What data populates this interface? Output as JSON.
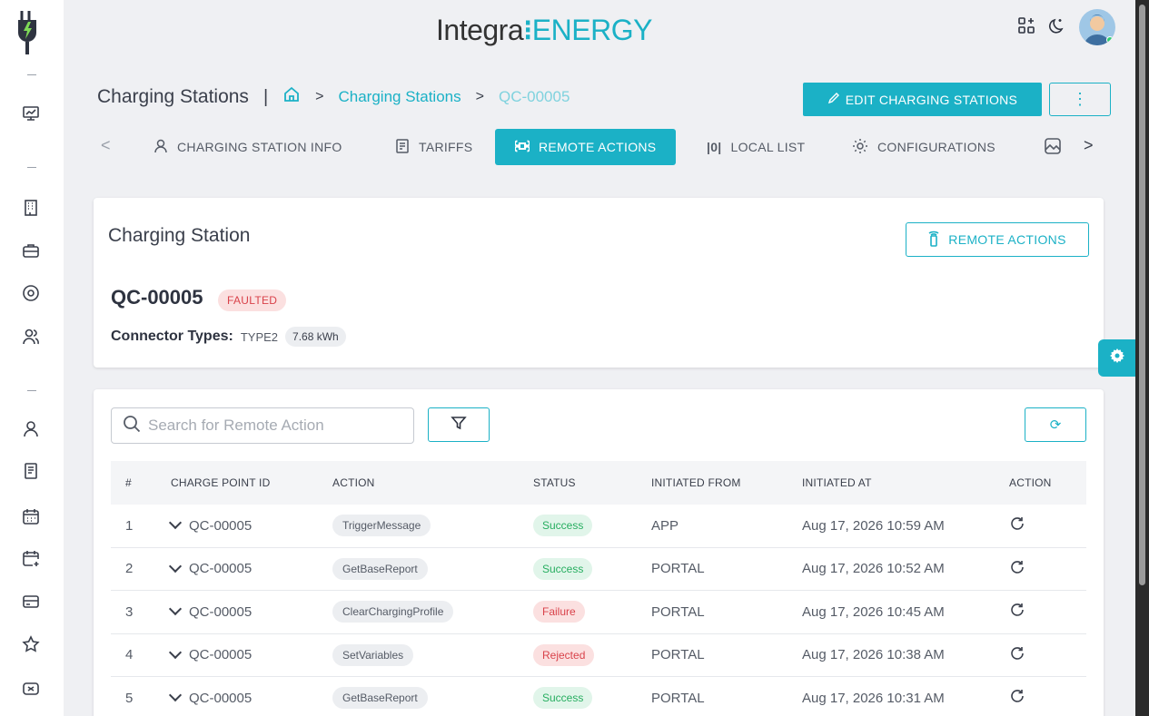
{
  "brand": {
    "part1": "Integra",
    "part2": "ENERGY"
  },
  "breadcrumb": {
    "title": "Charging Stations",
    "separator": "|",
    "link": "Charging Stations",
    "current": "QC-00005"
  },
  "header_actions": {
    "edit_label": "EDIT CHARGING STATIONS",
    "more_label": "⋮"
  },
  "tabs": [
    {
      "label": "CHARGING STATION INFO"
    },
    {
      "label": "TARIFFS"
    },
    {
      "label": "REMOTE ACTIONS"
    },
    {
      "label": "LOCAL LIST"
    },
    {
      "label": "CONFIGURATIONS"
    }
  ],
  "station_card": {
    "title": "Charging Station",
    "remote_button": "REMOTE ACTIONS",
    "station_id": "QC-00005",
    "status": "FAULTED",
    "connector_label": "Connector Types:",
    "connector_type": "TYPE2",
    "connector_kwh": "7.68 kWh"
  },
  "search": {
    "placeholder": "Search for Remote Action",
    "value": ""
  },
  "table": {
    "headers": [
      "#",
      "CHARGE POINT ID",
      "ACTION",
      "STATUS",
      "INITIATED FROM",
      "INITIATED AT",
      "ACTION"
    ],
    "rows": [
      {
        "n": "1",
        "cp": "QC-00005",
        "action": "TriggerMessage",
        "status": "Success",
        "from": "APP",
        "at": "Aug 17, 2026 10:59 AM"
      },
      {
        "n": "2",
        "cp": "QC-00005",
        "action": "GetBaseReport",
        "status": "Success",
        "from": "PORTAL",
        "at": "Aug 17, 2026 10:52 AM"
      },
      {
        "n": "3",
        "cp": "QC-00005",
        "action": "ClearChargingProfile",
        "status": "Failure",
        "from": "PORTAL",
        "at": "Aug 17, 2026 10:45 AM"
      },
      {
        "n": "4",
        "cp": "QC-00005",
        "action": "SetVariables",
        "status": "Rejected",
        "from": "PORTAL",
        "at": "Aug 17, 2026 10:38 AM"
      },
      {
        "n": "5",
        "cp": "QC-00005",
        "action": "GetBaseReport",
        "status": "Success",
        "from": "PORTAL",
        "at": "Aug 17, 2026 10:31 AM"
      }
    ]
  },
  "colors": {
    "accent": "#1bb1c6",
    "success": "#27ae60",
    "danger": "#d9424a"
  }
}
